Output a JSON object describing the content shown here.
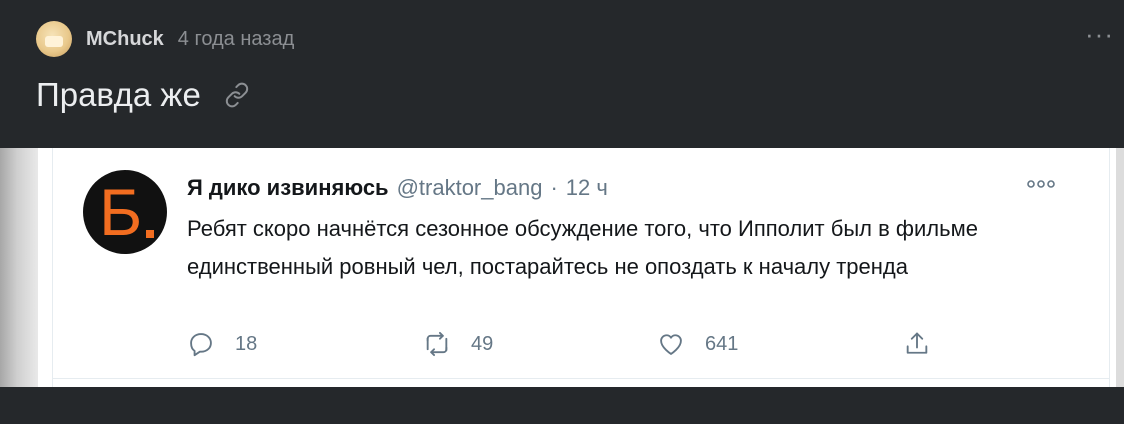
{
  "post": {
    "author": "MChuck",
    "time": "4 года назад",
    "more": "···",
    "title": "Правда же"
  },
  "tweet": {
    "avatar_letter": "Б",
    "name": "Я дико извиняюсь",
    "handle": "@traktor_bang",
    "separator": "·",
    "time": "12 ч",
    "text": "Ребят скоро начнётся сезонное обсуждение того, что Ипполит был в фильме единственный ровный чел, постарайтесь не опоздать к началу тренда",
    "replies": "18",
    "retweets": "49",
    "likes": "641"
  },
  "icons": {
    "link": "link-icon",
    "reply": "reply-icon",
    "retweet": "retweet-icon",
    "like": "heart-icon",
    "share": "share-icon"
  },
  "colors": {
    "background": "#25282b",
    "avatar_accent": "#f26d20",
    "tweet_text": "#14171a",
    "tweet_meta": "#657786"
  }
}
